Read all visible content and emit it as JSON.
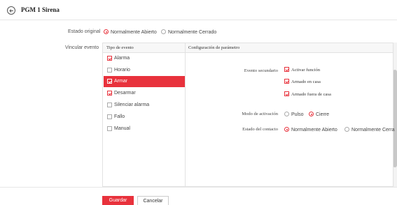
{
  "header": {
    "title": "PGM 1 Sirena"
  },
  "estado_original": {
    "label": "Estado original",
    "options": [
      {
        "label": "Normalmente Abierto",
        "selected": true
      },
      {
        "label": "Normalmente Cerrado",
        "selected": false
      }
    ]
  },
  "vincular_evento": {
    "label": "Vincular evento"
  },
  "panel": {
    "col_event_header": "Tipo de evento",
    "col_config_header": "Configuración de parámetro",
    "events": [
      {
        "label": "Alarma",
        "checked": true,
        "selected": false
      },
      {
        "label": "Horario",
        "checked": false,
        "selected": false
      },
      {
        "label": "Armar",
        "checked": true,
        "selected": true
      },
      {
        "label": "Desarmar",
        "checked": true,
        "selected": false
      },
      {
        "label": "Silenciar alarma",
        "checked": false,
        "selected": false
      },
      {
        "label": "Fallo",
        "checked": false,
        "selected": false
      },
      {
        "label": "Manual",
        "checked": false,
        "selected": false
      }
    ],
    "config": {
      "evento_secundario_label": "Evento secundario",
      "evento_secundario_options": [
        "Activar función",
        "Armado en casa",
        "Armado fuera de casa"
      ],
      "modo_label": "Modo de activación",
      "modo_options": [
        {
          "label": "Pulso",
          "selected": false
        },
        {
          "label": "Cierre",
          "selected": true
        }
      ],
      "estado_contacto_label": "Estado del contacto",
      "estado_contacto_options": [
        {
          "label": "Normalmente Abierto",
          "selected": true
        },
        {
          "label": "Normalmente Cerra",
          "selected": false
        }
      ]
    }
  },
  "footer": {
    "save_label": "Guardar",
    "cancel_label": "Cancelar"
  },
  "colors": {
    "accent": "#e8323c"
  }
}
